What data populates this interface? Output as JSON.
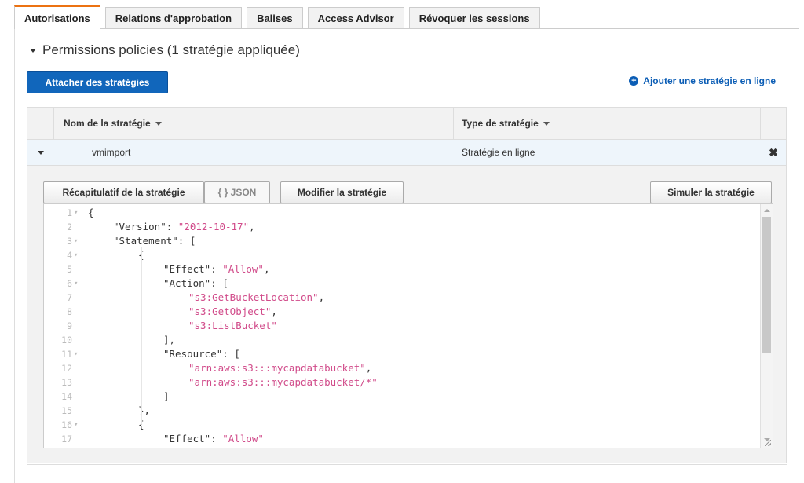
{
  "tabs": [
    {
      "label": "Autorisations",
      "active": true
    },
    {
      "label": "Relations d'approbation",
      "active": false
    },
    {
      "label": "Balises",
      "active": false
    },
    {
      "label": "Access Advisor",
      "active": false
    },
    {
      "label": "Révoquer les sessions",
      "active": false
    }
  ],
  "section": {
    "title": "Permissions policies (1 stratégie appliquée)"
  },
  "actions": {
    "attach_label": "Attacher des stratégies",
    "inline_label": "Ajouter une stratégie en ligne",
    "inline_icon": "plus-circle-icon"
  },
  "table": {
    "headers": [
      "Nom de la stratégie",
      "Type de stratégie"
    ],
    "row": {
      "name": "vmimport",
      "type": "Stratégie en ligne"
    },
    "remove_glyph": "✖"
  },
  "detail": {
    "summary_label": "Récapitulatif de la stratégie",
    "json_label": "{ } JSON",
    "edit_label": "Modifier la stratégie",
    "simulate_label": "Simuler la stratégie"
  },
  "editor": {
    "lines": [
      {
        "n": "1",
        "fold": true
      },
      {
        "n": "2",
        "fold": false
      },
      {
        "n": "3",
        "fold": true
      },
      {
        "n": "4",
        "fold": true
      },
      {
        "n": "5",
        "fold": false
      },
      {
        "n": "6",
        "fold": true
      },
      {
        "n": "7",
        "fold": false
      },
      {
        "n": "8",
        "fold": false
      },
      {
        "n": "9",
        "fold": false
      },
      {
        "n": "10",
        "fold": false
      },
      {
        "n": "11",
        "fold": true
      },
      {
        "n": "12",
        "fold": false
      },
      {
        "n": "13",
        "fold": false
      },
      {
        "n": "14",
        "fold": false
      },
      {
        "n": "15",
        "fold": false
      },
      {
        "n": "16",
        "fold": true
      },
      {
        "n": "17",
        "fold": false
      }
    ],
    "tokens": {
      "open_brace": "{",
      "version_key": "\"Version\"",
      "version_val": "\"2012-10-17\"",
      "statement_key": "\"Statement\"",
      "open_bracket": "[",
      "effect_key": "\"Effect\"",
      "allow_val": "\"Allow\"",
      "action_key": "\"Action\"",
      "a1": "\"s3:GetBucketLocation\"",
      "a2": "\"s3:GetObject\"",
      "a3": "\"s3:ListBucket\"",
      "close_bracket_comma": "],",
      "resource_key": "\"Resource\"",
      "r1": "\"arn:aws:s3:::mycapdatabucket\"",
      "r2": "\"arn:aws:s3:::mycapdatabucket/*\"",
      "close_bracket": "]",
      "close_brace_comma": "},",
      "open_brace_2": "{",
      "effect_key_2": "\"Effect\"",
      "allow_val_2": "\"Allow\""
    }
  }
}
